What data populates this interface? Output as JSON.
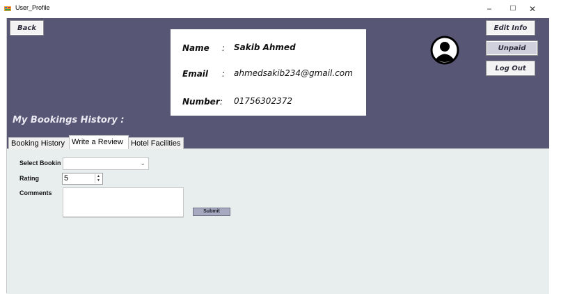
{
  "window": {
    "title": "User_Profile",
    "minimize_glyph": "−",
    "maximize_glyph": "☐",
    "close_glyph": "✕"
  },
  "header": {
    "back_label": "Back",
    "edit_info_label": "Edit Info",
    "unpaid_label": "Unpaid",
    "logout_label": "Log Out",
    "background_color": "#575775"
  },
  "profile": {
    "name_label": "Name",
    "name_sep": ":",
    "name_value": "Sakib Ahmed",
    "email_label": "Email",
    "email_sep": ":",
    "email_value": "ahmedsakib234@gmail.com",
    "number_label": "Number",
    "number_sep": ":",
    "number_value": "01756302372",
    "avatar_icon": "user-circle-icon"
  },
  "history": {
    "title": "My Bookings History :"
  },
  "tabs": [
    {
      "label": "Booking History",
      "active": false
    },
    {
      "label": "Write a Review",
      "active": true
    },
    {
      "label": "Hotel Facilities",
      "active": false
    }
  ],
  "review_form": {
    "select_booking_label": "Select Bookin",
    "select_booking_value": "",
    "rating_label": "Rating",
    "rating_value": "5",
    "comments_label": "Comments",
    "comments_value": "",
    "submit_label": "Submit"
  }
}
